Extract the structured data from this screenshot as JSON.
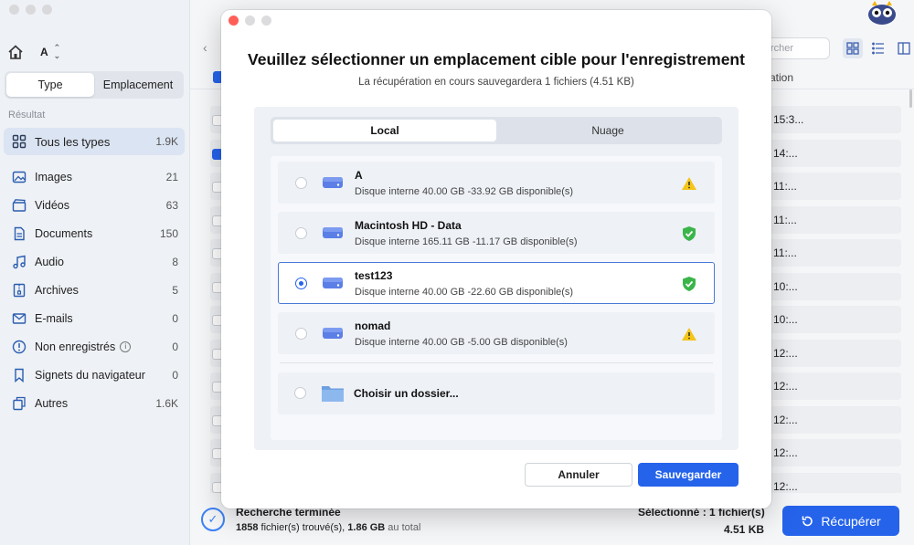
{
  "sidebar": {
    "drive_name": "A",
    "tabs": [
      {
        "label": "Type"
      },
      {
        "label": "Emplacement"
      }
    ],
    "section_label": "Résultat",
    "items": [
      {
        "label": "Tous les types",
        "count": "1.9K",
        "icon": "grid-icon"
      },
      {
        "label": "Images",
        "count": "21",
        "icon": "image-icon"
      },
      {
        "label": "Vidéos",
        "count": "63",
        "icon": "video-icon"
      },
      {
        "label": "Documents",
        "count": "150",
        "icon": "document-icon"
      },
      {
        "label": "Audio",
        "count": "8",
        "icon": "music-icon"
      },
      {
        "label": "Archives",
        "count": "5",
        "icon": "archive-icon"
      },
      {
        "label": "E-mails",
        "count": "0",
        "icon": "mail-icon"
      },
      {
        "label": "Non enregistrés",
        "count": "0",
        "icon": "info-icon"
      },
      {
        "label": "Signets du navigateur",
        "count": "0",
        "icon": "bookmark-icon"
      },
      {
        "label": "Autres",
        "count": "1.6K",
        "icon": "other-icon"
      }
    ]
  },
  "main": {
    "search_placeholder": "rcher",
    "column_header": "ation",
    "row_times": [
      "15:3...",
      "14:...",
      "11:...",
      "11:...",
      "11:...",
      "10:...",
      "10:...",
      "12:...",
      "12:...",
      "12:...",
      "12:...",
      "12:..."
    ]
  },
  "status": {
    "title": "Recherche terminée",
    "files_count": "1858",
    "files_text": " fichier(s) trouvé(s), ",
    "size": "1.86 GB",
    "size_suffix": " au total",
    "selected": "Sélectionné : 1 fichier(s)",
    "selected_size": "4.51 KB",
    "recover_label": "Récupérer"
  },
  "modal": {
    "title": "Veuillez sélectionner un emplacement cible pour l'enregistrement",
    "subtitle": "La récupération en cours sauvegardera 1 fichiers (4.51 KB)",
    "tabs": [
      {
        "label": "Local"
      },
      {
        "label": "Nuage"
      }
    ],
    "drives": [
      {
        "name": "A",
        "info": "Disque interne 40.00 GB -33.92 GB disponible(s)",
        "badge": "warning-icon"
      },
      {
        "name": "Macintosh HD - Data",
        "info": "Disque interne 165.11 GB -11.17 GB disponible(s)",
        "badge": "shield-check-icon"
      },
      {
        "name": "test123",
        "info": "Disque interne 40.00 GB -22.60 GB disponible(s)",
        "badge": "shield-check-icon",
        "selected": true
      },
      {
        "name": "nomad",
        "info": "Disque interne 40.00 GB -5.00 GB disponible(s)",
        "badge": "warning-icon"
      }
    ],
    "choose_folder": "Choisir un dossier...",
    "cancel_label": "Annuler",
    "save_label": "Sauvegarder"
  },
  "colors": {
    "accent": "#2563eb",
    "warning": "#f5c518",
    "success": "#3bb54a",
    "close": "#ff5f57"
  }
}
